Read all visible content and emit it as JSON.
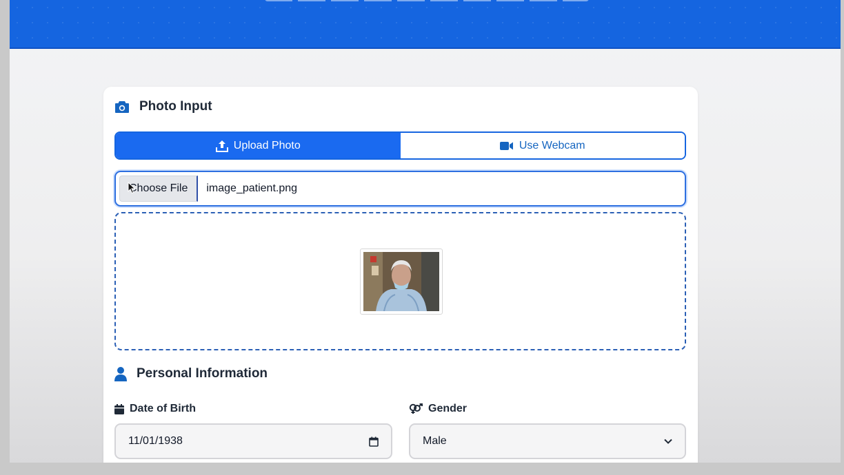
{
  "photo_input": {
    "title": "Photo Input",
    "tabs": [
      {
        "label": "Upload Photo",
        "icon": "upload-icon",
        "active": true
      },
      {
        "label": "Use Webcam",
        "icon": "video-camera-icon",
        "active": false
      }
    ],
    "file_input": {
      "button_label": "Choose File",
      "file_name": "image_patient.png"
    },
    "preview": {
      "icon": "patient-photo-thumbnail"
    }
  },
  "personal_info": {
    "title": "Personal Information",
    "date_of_birth": {
      "label": "Date of Birth",
      "value": "11/01/1938"
    },
    "gender": {
      "label": "Gender",
      "value": "Male"
    }
  },
  "colors": {
    "primary": "#1a6af0",
    "header": "#1565e0",
    "dropzone_border": "#2a5fb5"
  }
}
